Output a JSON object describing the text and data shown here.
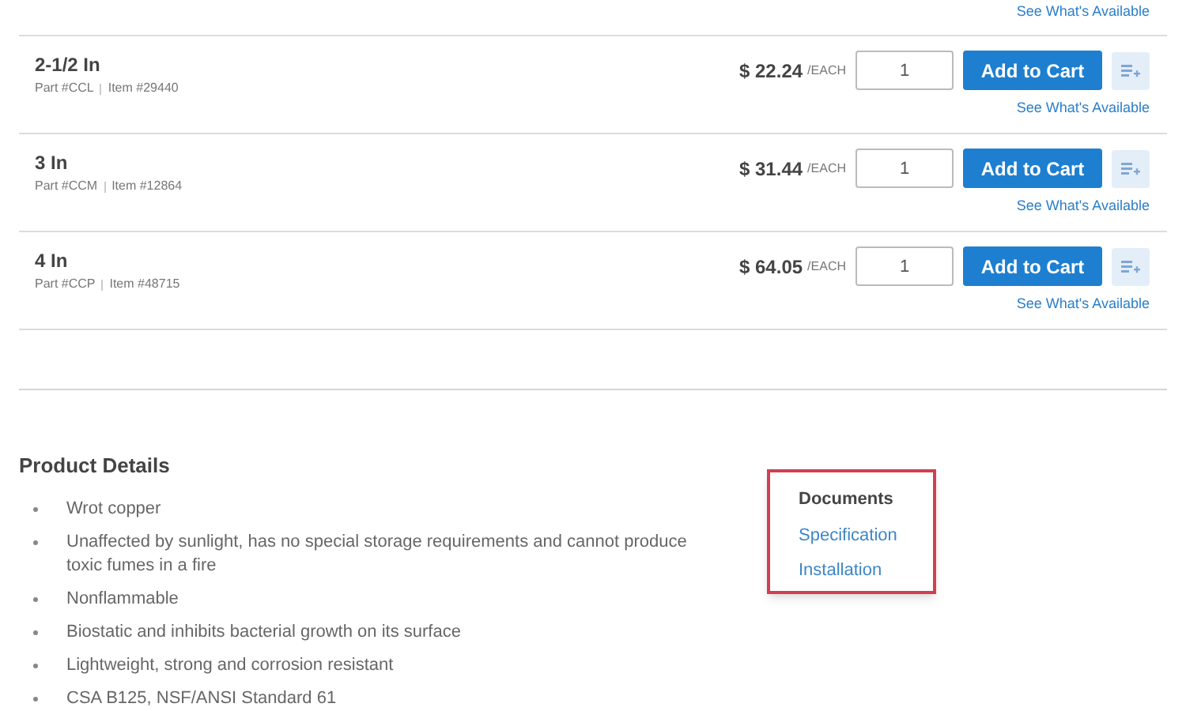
{
  "top_link": "See What's Available",
  "products": [
    {
      "size": "2-1/2 In",
      "part": "Part #CCL",
      "item": "Item #29440",
      "price": "$ 22.24",
      "unit": "/EACH",
      "quantity": "1",
      "button": "Add to Cart",
      "link": "See What's Available"
    },
    {
      "size": "3 In",
      "part": "Part #CCM",
      "item": "Item #12864",
      "price": "$ 31.44",
      "unit": "/EACH",
      "quantity": "1",
      "button": "Add to Cart",
      "link": "See What's Available"
    },
    {
      "size": "4 In",
      "part": "Part #CCP",
      "item": "Item #48715",
      "price": "$ 64.05",
      "unit": "/EACH",
      "quantity": "1",
      "button": "Add to Cart",
      "link": "See What's Available"
    }
  ],
  "details": {
    "title": "Product Details",
    "bullets": [
      "Wrot copper",
      "Unaffected by sunlight, has no special storage requirements and cannot produce toxic fumes in a fire",
      "Nonflammable",
      "Biostatic and inhibits bacterial growth on its surface",
      "Lightweight, strong and corrosion resistant",
      "CSA B125, NSF/ANSI Standard 61"
    ]
  },
  "documents": {
    "title": "Documents",
    "links": [
      "Specification",
      "Installation"
    ]
  }
}
